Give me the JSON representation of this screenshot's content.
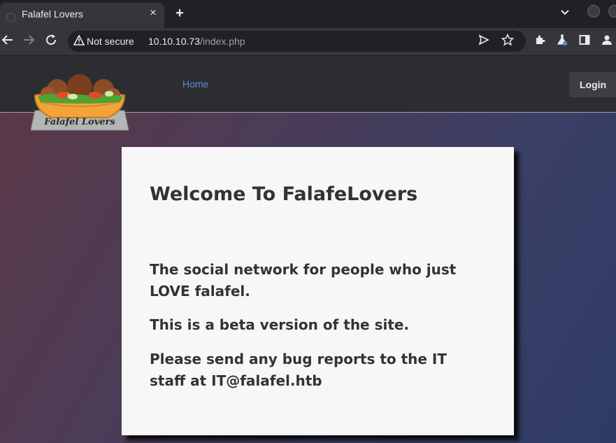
{
  "browser": {
    "tab_title": "Falafel Lovers",
    "tab_close": "×",
    "new_tab": "+",
    "security_label": "Not secure",
    "url_host": "10.10.10.73",
    "url_path": "/index.php"
  },
  "site": {
    "logo_text": "Falafel Lovers",
    "nav": {
      "home": "Home",
      "login": "Login"
    }
  },
  "content": {
    "heading": "Welcome To FalafeLovers",
    "para1": "The social network for people who just LOVE falafel.",
    "para2": "This is a beta version of the site.",
    "para3": "Please send any bug reports to the IT staff at IT@falafel.htb"
  },
  "icons": [
    "back-icon",
    "forward-icon",
    "reload-icon",
    "warning-icon",
    "send-icon",
    "star-icon",
    "extensions-icon",
    "labs-icon",
    "sidepanel-icon",
    "profile-icon"
  ]
}
